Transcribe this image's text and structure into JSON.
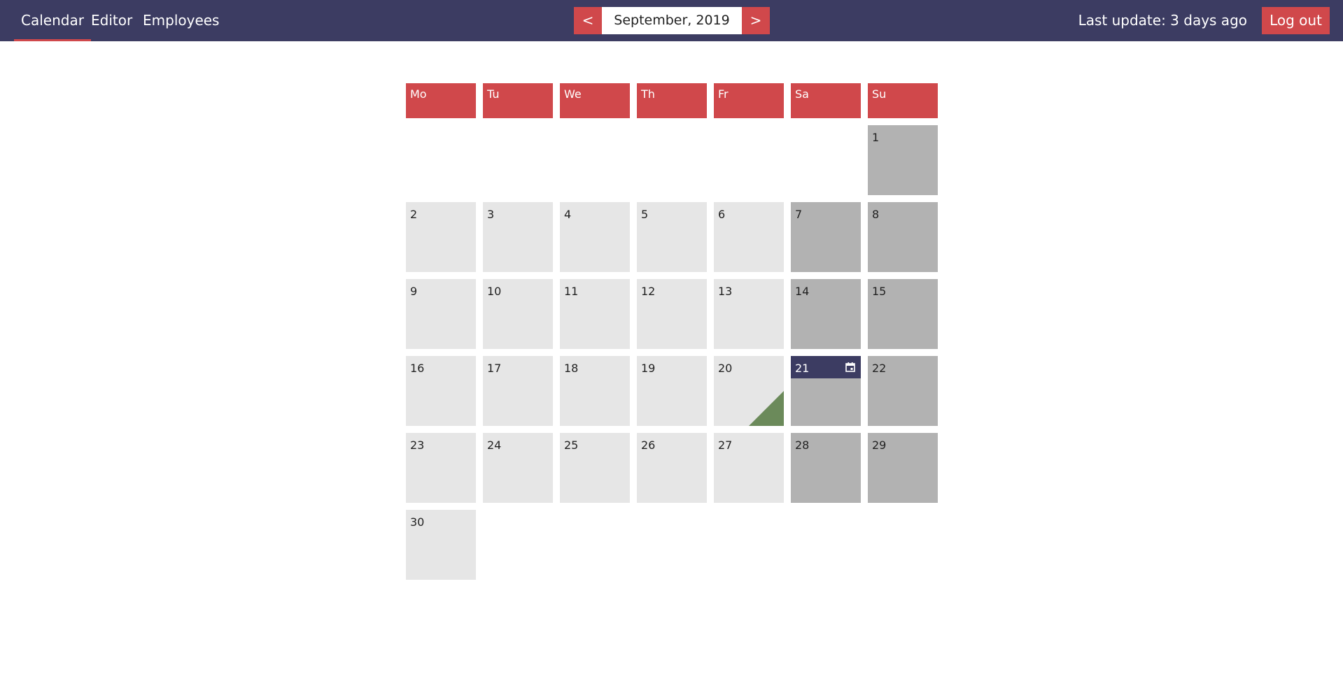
{
  "nav": {
    "items": [
      "Calendar",
      "Editor",
      "Employees"
    ],
    "active": "Calendar"
  },
  "month_nav": {
    "prev_label": "<",
    "month_label": "September, 2019",
    "next_label": ">"
  },
  "header_right": {
    "last_update": "Last update: 3 days ago",
    "logout_label": "Log out"
  },
  "calendar": {
    "weekdays": [
      "Mo",
      "Tu",
      "We",
      "Th",
      "Fr",
      "Sa",
      "Su"
    ],
    "days": [
      "1",
      "2",
      "3",
      "4",
      "5",
      "6",
      "7",
      "8",
      "9",
      "10",
      "11",
      "12",
      "13",
      "14",
      "15",
      "16",
      "17",
      "18",
      "19",
      "20",
      "21",
      "22",
      "23",
      "24",
      "25",
      "26",
      "27",
      "28",
      "29",
      "30"
    ],
    "today": "21",
    "marked_day": "20",
    "today_icon": "calendar-icon"
  },
  "colors": {
    "topbar": "#3c3c62",
    "accent": "#d0484b",
    "weekday_cell": "#e6e6e6",
    "weekend_cell": "#b2b2b2",
    "marker": "#6b8a5a"
  }
}
